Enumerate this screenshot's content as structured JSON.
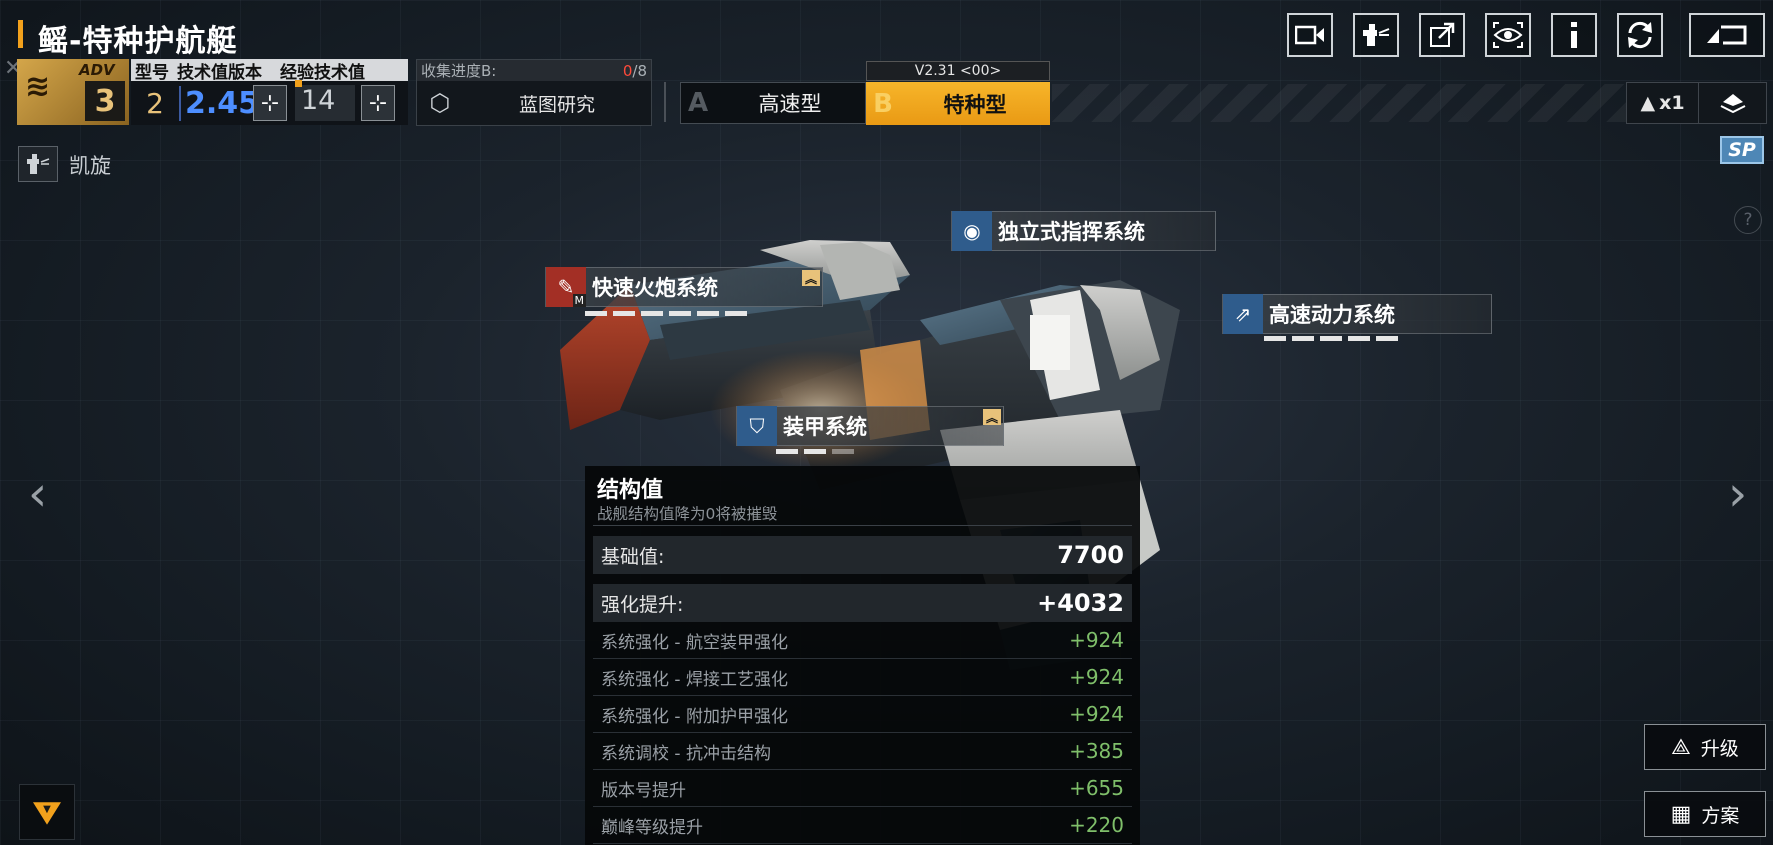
{
  "header": {
    "title": "鳐-特种护航艇",
    "top_icons": [
      "video-camera-icon",
      "officer-icon",
      "share-icon",
      "view-icon",
      "info-icon",
      "refresh-icon",
      "back-icon"
    ]
  },
  "rank": {
    "badge_text": "ADV",
    "level": "3"
  },
  "stats_bar": {
    "type_label": "型号",
    "tech_label": "技术值版本",
    "exp_label": "经验技术值",
    "type_value": "2",
    "tech_value": "2.45",
    "exp_value": "14",
    "plus_symbol": "⊹"
  },
  "collection": {
    "label": "收集进度B:",
    "progress_current": "0",
    "progress_total": "/8",
    "research_label": "蓝图研究"
  },
  "variants": {
    "version": "V2.31 <00>",
    "a_letter": "A",
    "a_name": "高速型",
    "b_letter": "B",
    "b_name": "特种型",
    "selected": "B"
  },
  "multiplier": {
    "text": "x1"
  },
  "sp_badge": "SP",
  "help_symbol": "?",
  "pilot": {
    "name": "凯旋"
  },
  "systems": [
    {
      "name": "独立式指挥系统",
      "icon": "command-icon"
    },
    {
      "name": "快速火炮系统",
      "icon": "cannon-icon",
      "sub": "M"
    },
    {
      "name": "高速动力系统",
      "icon": "engine-icon"
    },
    {
      "name": "装甲系统",
      "icon": "armor-icon"
    }
  ],
  "structure_panel": {
    "title": "结构值",
    "subtitle": "战舰结构值降为0将被摧毁",
    "base_label": "基础值:",
    "base_value": "7700",
    "bonus_label": "强化提升:",
    "bonus_value": "+4032",
    "rows": [
      {
        "label": "系统强化 - 航空装甲强化",
        "value": "+924"
      },
      {
        "label": "系统强化 - 焊接工艺强化",
        "value": "+924"
      },
      {
        "label": "系统强化 - 附加护甲强化",
        "value": "+924"
      },
      {
        "label": "系统调校 - 抗冲击结构",
        "value": "+385"
      },
      {
        "label": "版本号提升",
        "value": "+655"
      },
      {
        "label": "巅峰等级提升",
        "value": "+220"
      }
    ]
  },
  "actions": {
    "upgrade_label": "升级",
    "plan_label": "方案"
  },
  "colors": {
    "accent": "#f2a11c",
    "tech_blue": "#4d8eff",
    "bonus_green": "#7fbf6a",
    "progress_red": "#ff4a3a"
  }
}
